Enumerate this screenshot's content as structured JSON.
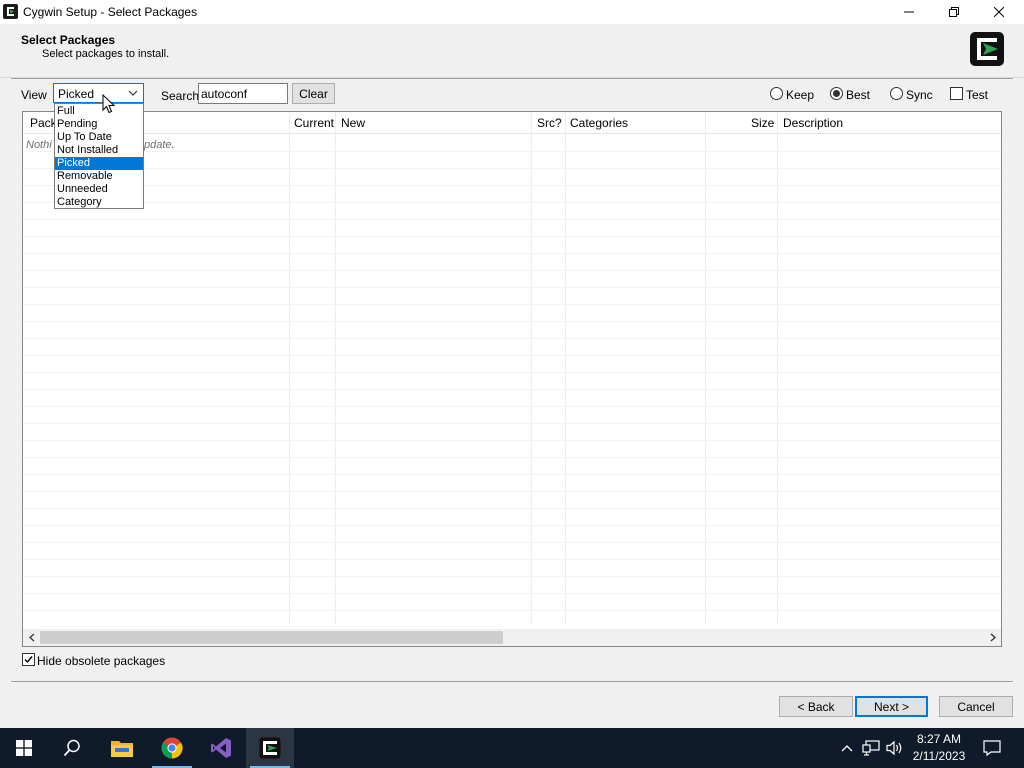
{
  "window": {
    "title": "Cygwin Setup - Select Packages"
  },
  "header": {
    "title": "Select Packages",
    "subtitle": "Select packages to install."
  },
  "toolbar": {
    "view_label": "View",
    "view_value": "Picked",
    "view_options": [
      "Full",
      "Pending",
      "Up To Date",
      "Not Installed",
      "Picked",
      "Removable",
      "Unneeded",
      "Category"
    ],
    "view_selected_index": 4,
    "search_label": "Search",
    "search_value": "autoconf",
    "clear_label": "Clear",
    "radios": [
      {
        "label": "Keep",
        "checked": false
      },
      {
        "label": "Best",
        "checked": true
      },
      {
        "label": "Sync",
        "checked": false
      }
    ],
    "test_label": "Test",
    "test_checked": false
  },
  "grid": {
    "columns": [
      "Package",
      "Current",
      "New",
      "Src?",
      "Categories",
      "Size",
      "Description"
    ],
    "visible_package_header": "Pack",
    "empty_message_visible": "Nothi",
    "empty_message_tail": "pdate."
  },
  "options": {
    "hide_obsolete_label": "Hide obsolete packages",
    "hide_obsolete_checked": true
  },
  "buttons": {
    "back": "< Back",
    "next": "Next >",
    "cancel": "Cancel"
  },
  "taskbar": {
    "time": "8:27 AM",
    "date": "2/11/2023",
    "apps": [
      "start-icon",
      "search-icon",
      "file-explorer-icon",
      "chrome-icon",
      "visual-studio-icon",
      "cygwin-setup-icon"
    ]
  },
  "colors": {
    "accent": "#0078d7",
    "taskbar": "#0f1b2a",
    "cygwin_green": "#2ea44f"
  }
}
